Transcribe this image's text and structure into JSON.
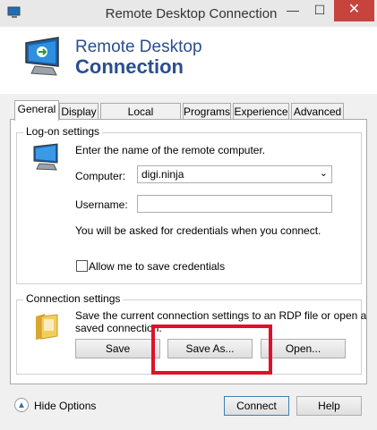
{
  "window": {
    "title": "Remote Desktop Connection",
    "close_glyph": "✕",
    "min_glyph": "—",
    "max_glyph": "☐"
  },
  "banner": {
    "line1": "Remote Desktop",
    "line2": "Connection"
  },
  "tabs": [
    {
      "label": "General",
      "active": true
    },
    {
      "label": "Display"
    },
    {
      "label": "Local Resources"
    },
    {
      "label": "Programs"
    },
    {
      "label": "Experience"
    },
    {
      "label": "Advanced"
    }
  ],
  "logon": {
    "legend": "Log-on settings",
    "instruction": "Enter the name of the remote computer.",
    "computer_label": "Computer:",
    "computer_value": "digi.ninja",
    "username_label": "Username:",
    "username_value": "",
    "credentials_note": "You will be asked for credentials when you connect.",
    "allow_save_label": "Allow me to save credentials"
  },
  "connection": {
    "legend": "Connection settings",
    "description_line1": "Save the current connection settings to an RDP file or open a",
    "description_line2": "saved connection.",
    "save_label": "Save",
    "save_as_label": "Save As...",
    "open_label": "Open..."
  },
  "footer": {
    "hide_options_label": "Hide Options",
    "connect_label": "Connect",
    "help_label": "Help"
  }
}
